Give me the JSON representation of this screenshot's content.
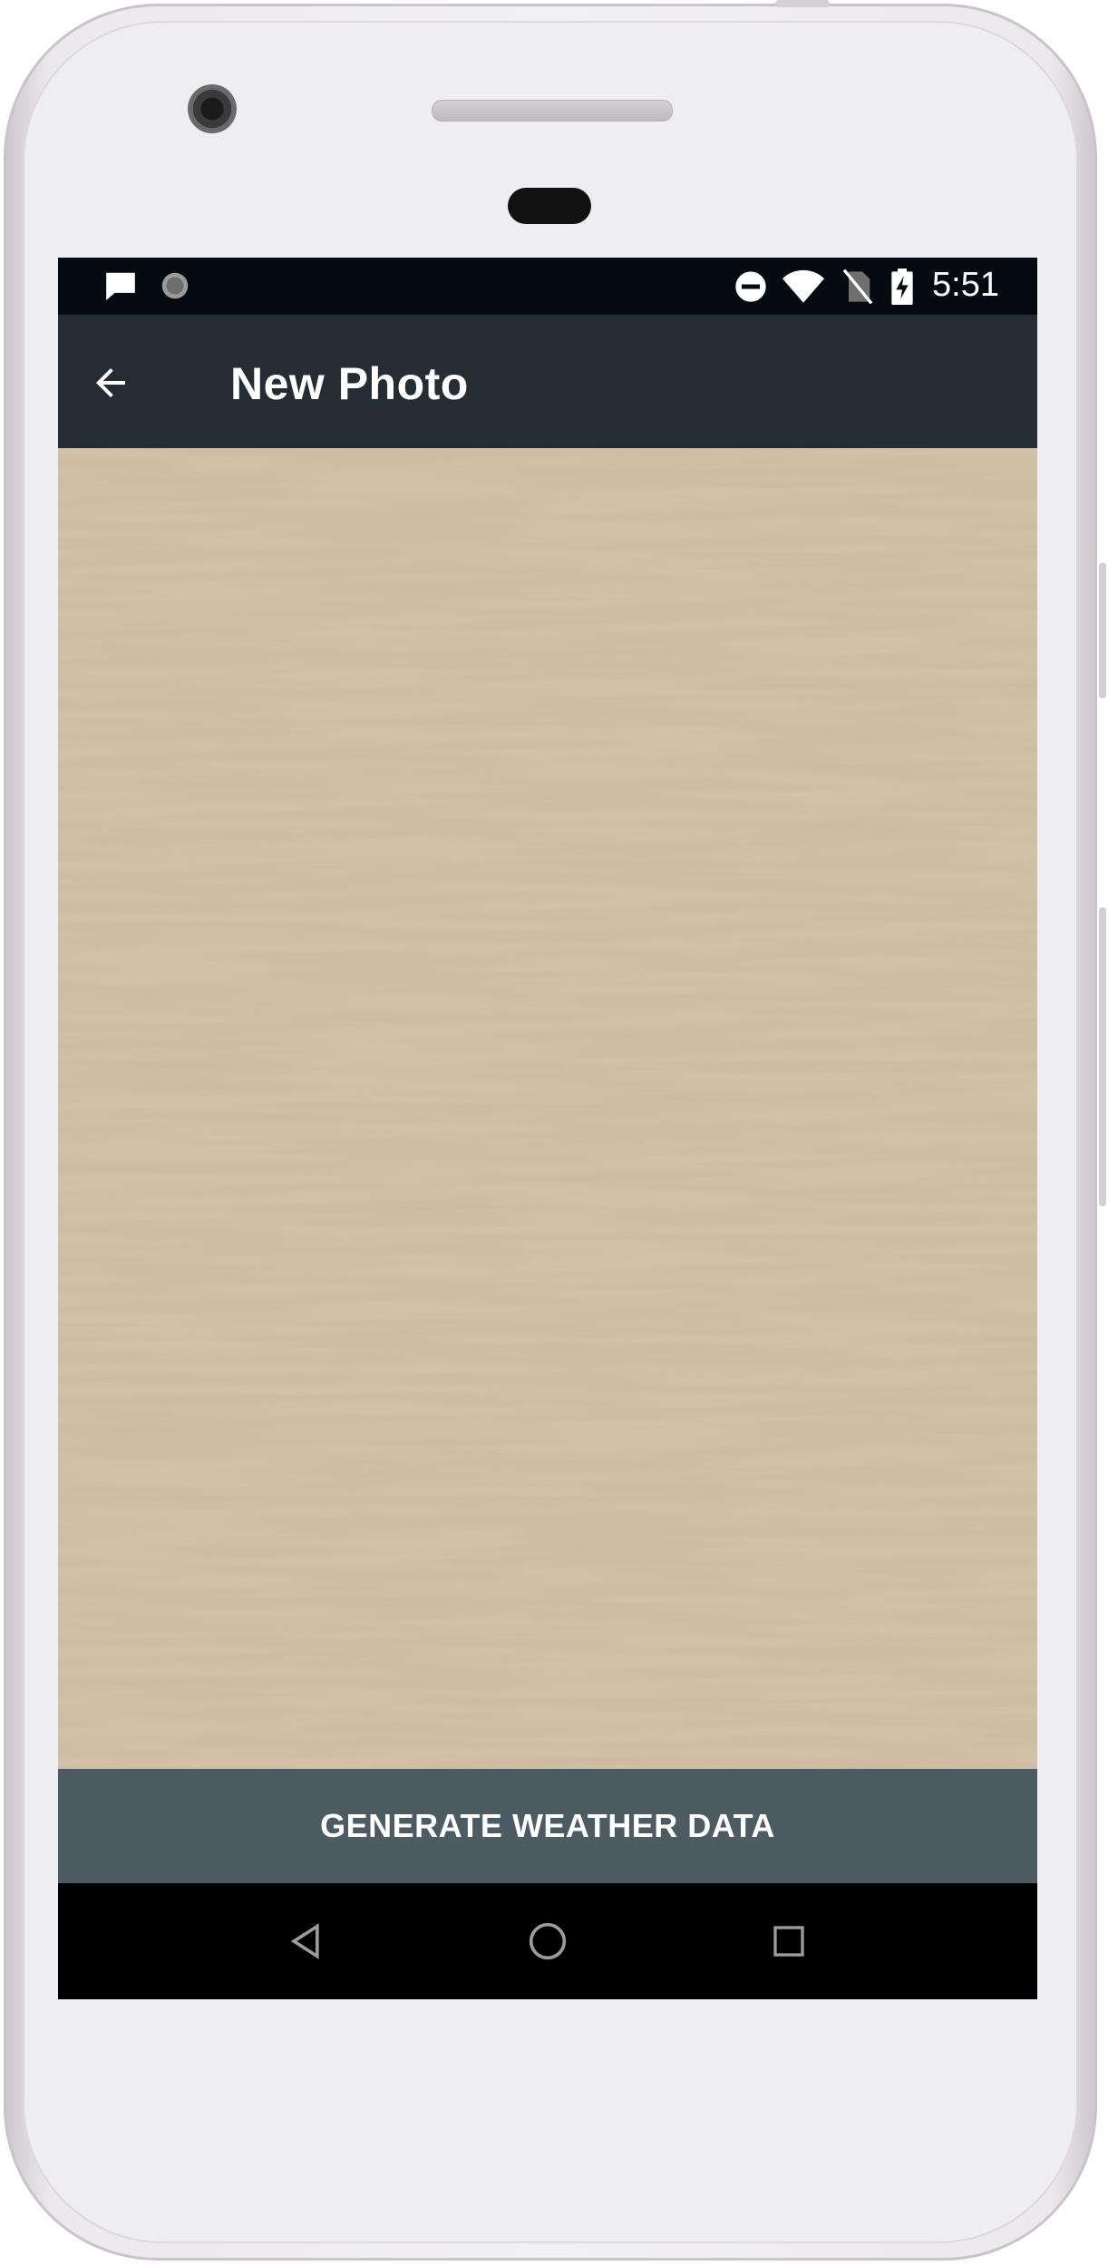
{
  "device": {
    "status_bar": {
      "time": "5:51",
      "left_icons": [
        "message-icon",
        "sync-circle-icon"
      ],
      "right_icons": [
        "do-not-disturb-icon",
        "wifi-icon",
        "no-sim-icon",
        "battery-charging-icon"
      ]
    },
    "nav_bar": {
      "icons": [
        "back-triangle-icon",
        "home-circle-icon",
        "recents-square-icon"
      ]
    }
  },
  "app_bar": {
    "title": "New Photo",
    "back_icon": "arrow-left-icon",
    "background": "#242d33"
  },
  "photo": {
    "description_icon": "wood-texture-photo"
  },
  "actions": {
    "generate_label": "GENERATE WEATHER DATA",
    "button_color": "#4d5b62"
  }
}
